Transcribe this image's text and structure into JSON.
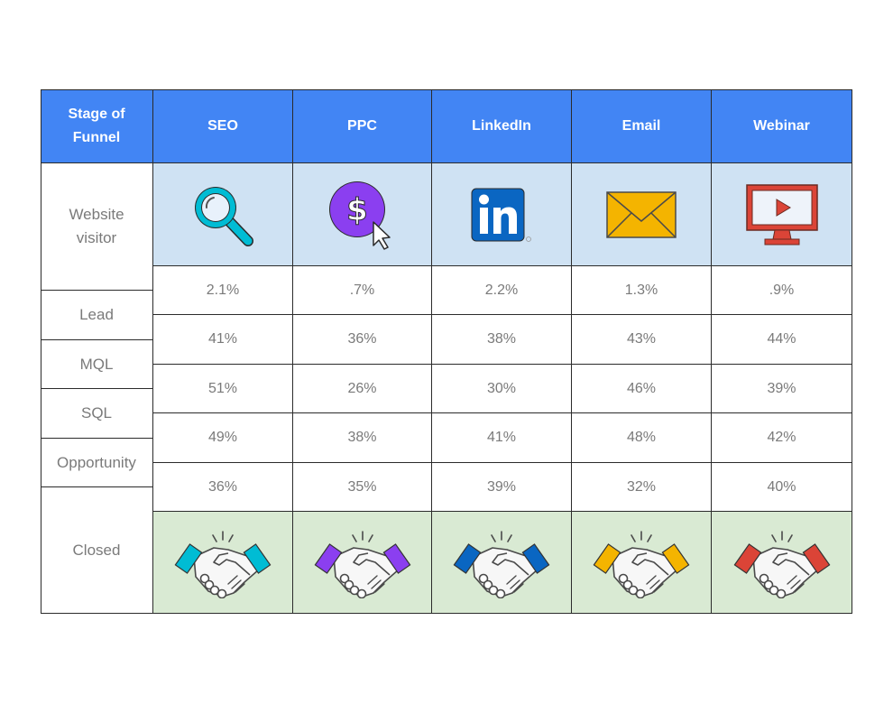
{
  "table": {
    "corner_header": "Stage of Funnel",
    "channels": [
      {
        "name": "SEO",
        "icon": "magnifier-icon",
        "accent": "#00bcd4"
      },
      {
        "name": "PPC",
        "icon": "dollar-click-icon",
        "accent": "#8b3ff0"
      },
      {
        "name": "LinkedIn",
        "icon": "linkedin-icon",
        "accent": "#0a66c2"
      },
      {
        "name": "Email",
        "icon": "envelope-icon",
        "accent": "#f4b400"
      },
      {
        "name": "Webinar",
        "icon": "monitor-play-icon",
        "accent": "#db4437"
      }
    ],
    "stages": [
      "Website visitor",
      "Lead",
      "MQL",
      "SQL",
      "Opportunity",
      "Closed"
    ],
    "conversion_rows": [
      [
        "2.1%",
        ".7%",
        "2.2%",
        "1.3%",
        ".9%"
      ],
      [
        "41%",
        "36%",
        "38%",
        "43%",
        "44%"
      ],
      [
        "51%",
        "26%",
        "30%",
        "46%",
        "39%"
      ],
      [
        "49%",
        "38%",
        "41%",
        "48%",
        "42%"
      ],
      [
        "36%",
        "35%",
        "39%",
        "32%",
        "40%"
      ]
    ],
    "closed_icon": "handshake-icon",
    "colors": {
      "header_bg": "#4285f4",
      "icon_row_bg": "#cfe2f3",
      "closed_row_bg": "#d9ead3"
    }
  }
}
